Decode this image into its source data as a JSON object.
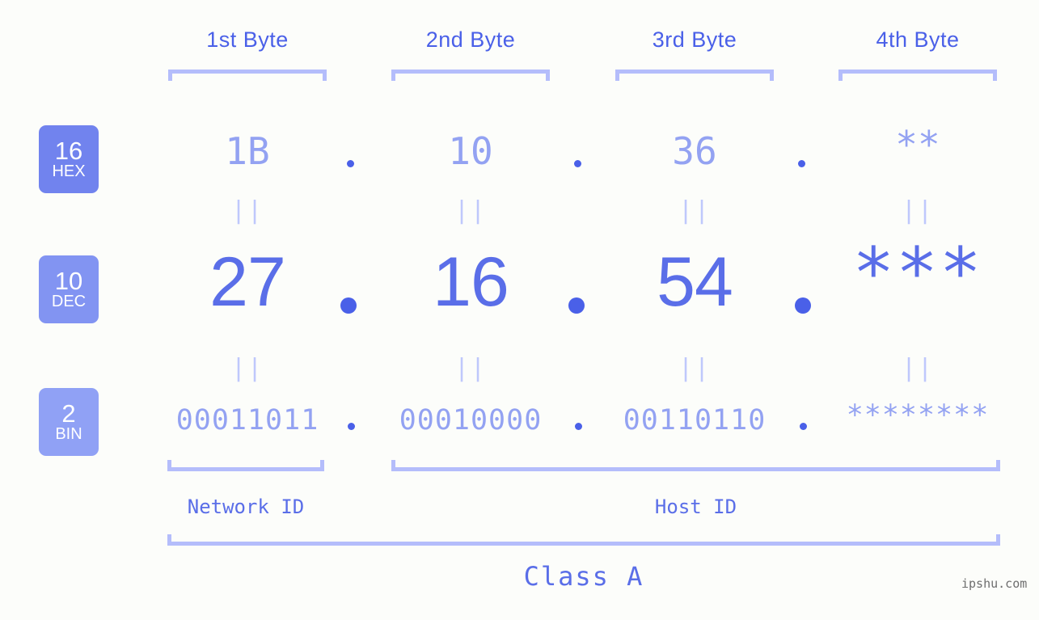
{
  "page": {
    "background": "#fcfdfa",
    "accent_dark": "#4a60e8",
    "accent_mid": "#5a6ee8",
    "accent_light": "#93a2f2",
    "accent_pale": "#b4bdfb"
  },
  "byte_headers": [
    {
      "label": "1st Byte"
    },
    {
      "label": "2nd Byte"
    },
    {
      "label": "3rd Byte"
    },
    {
      "label": "4th Byte"
    }
  ],
  "rows": [
    {
      "base": "16",
      "abbr": "HEX",
      "badge_color": "#7183ee",
      "values": [
        "1B",
        "10",
        "36",
        "**"
      ],
      "separator": "."
    },
    {
      "base": "10",
      "abbr": "DEC",
      "badge_color": "#8294f2",
      "values": [
        "27",
        "16",
        "54",
        "***"
      ],
      "separator": "."
    },
    {
      "base": "2",
      "abbr": "BIN",
      "badge_color": "#90a1f5",
      "values": [
        "00011011",
        "00010000",
        "00110110",
        "********"
      ],
      "separator": "."
    }
  ],
  "equals_marks": {
    "glyph": "||",
    "count_per_gap": 4
  },
  "regions": [
    {
      "label": "Network ID"
    },
    {
      "label": "Host ID"
    }
  ],
  "class": {
    "label": "Class A"
  },
  "watermark": {
    "text": "ipshu.com"
  }
}
